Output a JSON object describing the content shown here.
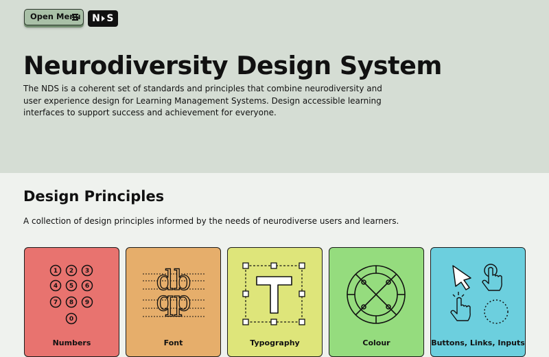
{
  "header": {
    "menu_label": "Open Menu",
    "logo_text": "N·S"
  },
  "hero": {
    "title": "Neurodiversity Design System",
    "intro": "The NDS is a coherent set of standards and principles that combine neurodiversity and user experience design for Learning Management Systems. Design accessible learning interfaces to support success and achievement for everyone."
  },
  "principles": {
    "heading": "Design Principles",
    "description": "A collection of design principles informed by the needs of neurodiverse users and learners.",
    "cards": [
      {
        "title": "Numbers",
        "color": "#e8736f",
        "icon": "numbers-icon"
      },
      {
        "title": "Font",
        "color": "#e6ae6b",
        "icon": "font-icon"
      },
      {
        "title": "Typography",
        "color": "#dee57a",
        "icon": "typography-icon"
      },
      {
        "title": "Colour",
        "color": "#95dc7e",
        "icon": "colour-icon"
      },
      {
        "title": "Buttons, Links, Inputs",
        "color": "#6ccfde",
        "icon": "buttons-links-inputs-icon"
      }
    ]
  }
}
